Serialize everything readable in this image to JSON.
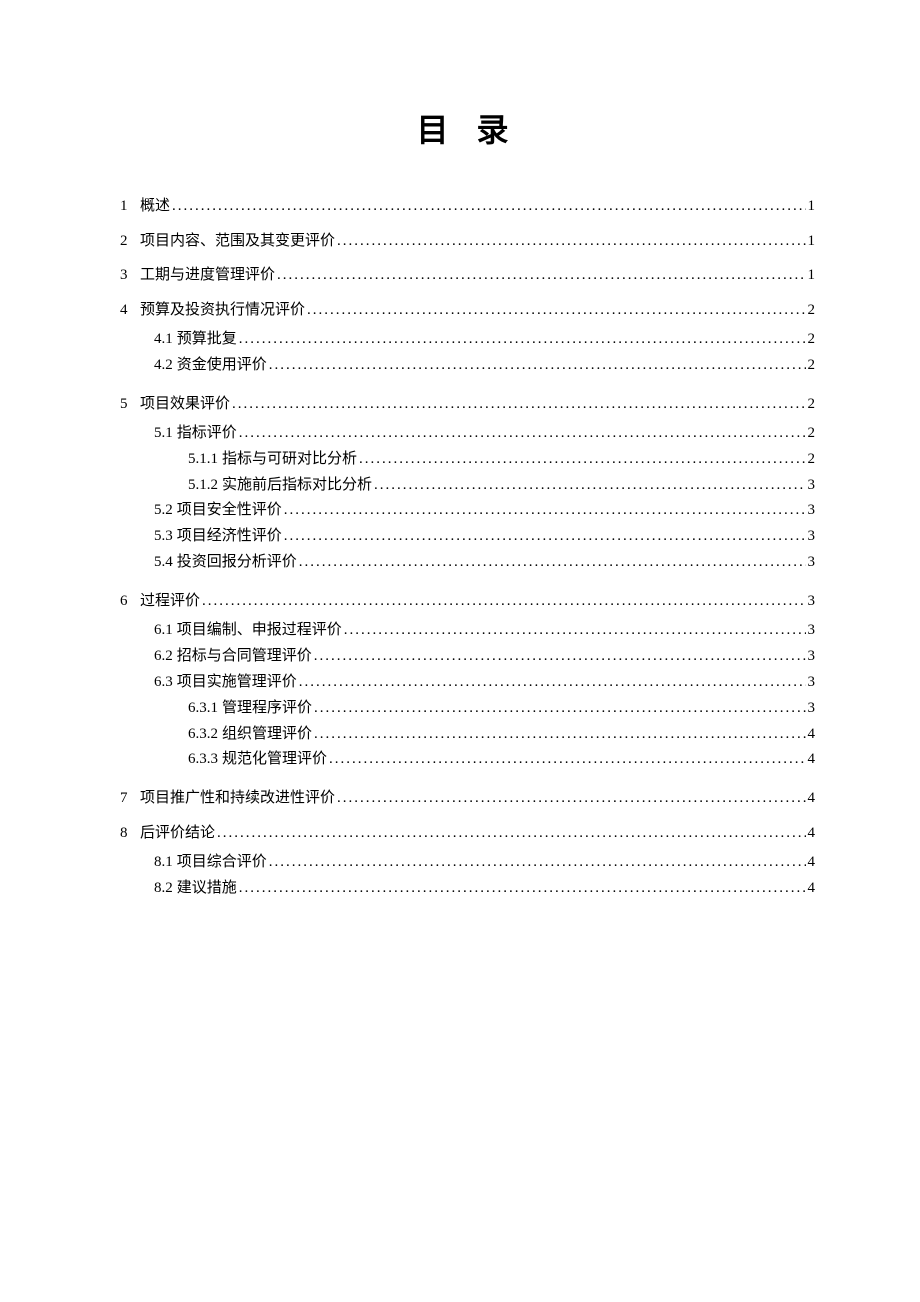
{
  "title": "目录",
  "entries": [
    {
      "level": 1,
      "num": "1",
      "label": "概述",
      "page": "1"
    },
    {
      "level": 1,
      "num": "2",
      "label": "项目内容、范围及其变更评价",
      "page": "1"
    },
    {
      "level": 1,
      "num": "3",
      "label": "工期与进度管理评价",
      "page": "1"
    },
    {
      "level": 1,
      "num": "4",
      "label": "预算及投资执行情况评价",
      "page": "2"
    },
    {
      "level": 2,
      "num": "4.1",
      "label": "预算批复",
      "page": "2"
    },
    {
      "level": 2,
      "num": "4.2",
      "label": "资金使用评价",
      "page": "2"
    },
    {
      "level": 1,
      "num": "5",
      "label": "项目效果评价",
      "page": "2"
    },
    {
      "level": 2,
      "num": "5.1",
      "label": "指标评价",
      "page": "2"
    },
    {
      "level": 3,
      "num": "5.1.1",
      "label": "指标与可研对比分析",
      "page": "2"
    },
    {
      "level": 3,
      "num": "5.1.2",
      "label": "实施前后指标对比分析",
      "page": "3"
    },
    {
      "level": 2,
      "num": "5.2",
      "label": "项目安全性评价",
      "page": "3"
    },
    {
      "level": 2,
      "num": "5.3",
      "label": "项目经济性评价",
      "page": "3"
    },
    {
      "level": 2,
      "num": "5.4",
      "label": "投资回报分析评价",
      "page": "3"
    },
    {
      "level": 1,
      "num": "6",
      "label": "过程评价",
      "page": "3"
    },
    {
      "level": 2,
      "num": "6.1",
      "label": "项目编制、申报过程评价",
      "page": "3"
    },
    {
      "level": 2,
      "num": "6.2",
      "label": "招标与合同管理评价",
      "page": "3"
    },
    {
      "level": 2,
      "num": "6.3",
      "label": "项目实施管理评价",
      "page": "3"
    },
    {
      "level": 3,
      "num": "6.3.1",
      "label": "管理程序评价",
      "page": "3"
    },
    {
      "level": 3,
      "num": "6.3.2",
      "label": "组织管理评价",
      "page": "4"
    },
    {
      "level": 3,
      "num": "6.3.3",
      "label": "规范化管理评价",
      "page": "4"
    },
    {
      "level": 1,
      "num": "7",
      "label": "项目推广性和持续改进性评价",
      "page": "4"
    },
    {
      "level": 1,
      "num": "8",
      "label": "后评价结论",
      "page": "4"
    },
    {
      "level": 2,
      "num": "8.1",
      "label": "项目综合评价",
      "page": "4"
    },
    {
      "level": 2,
      "num": "8.2",
      "label": "建议措施",
      "page": "4"
    }
  ]
}
